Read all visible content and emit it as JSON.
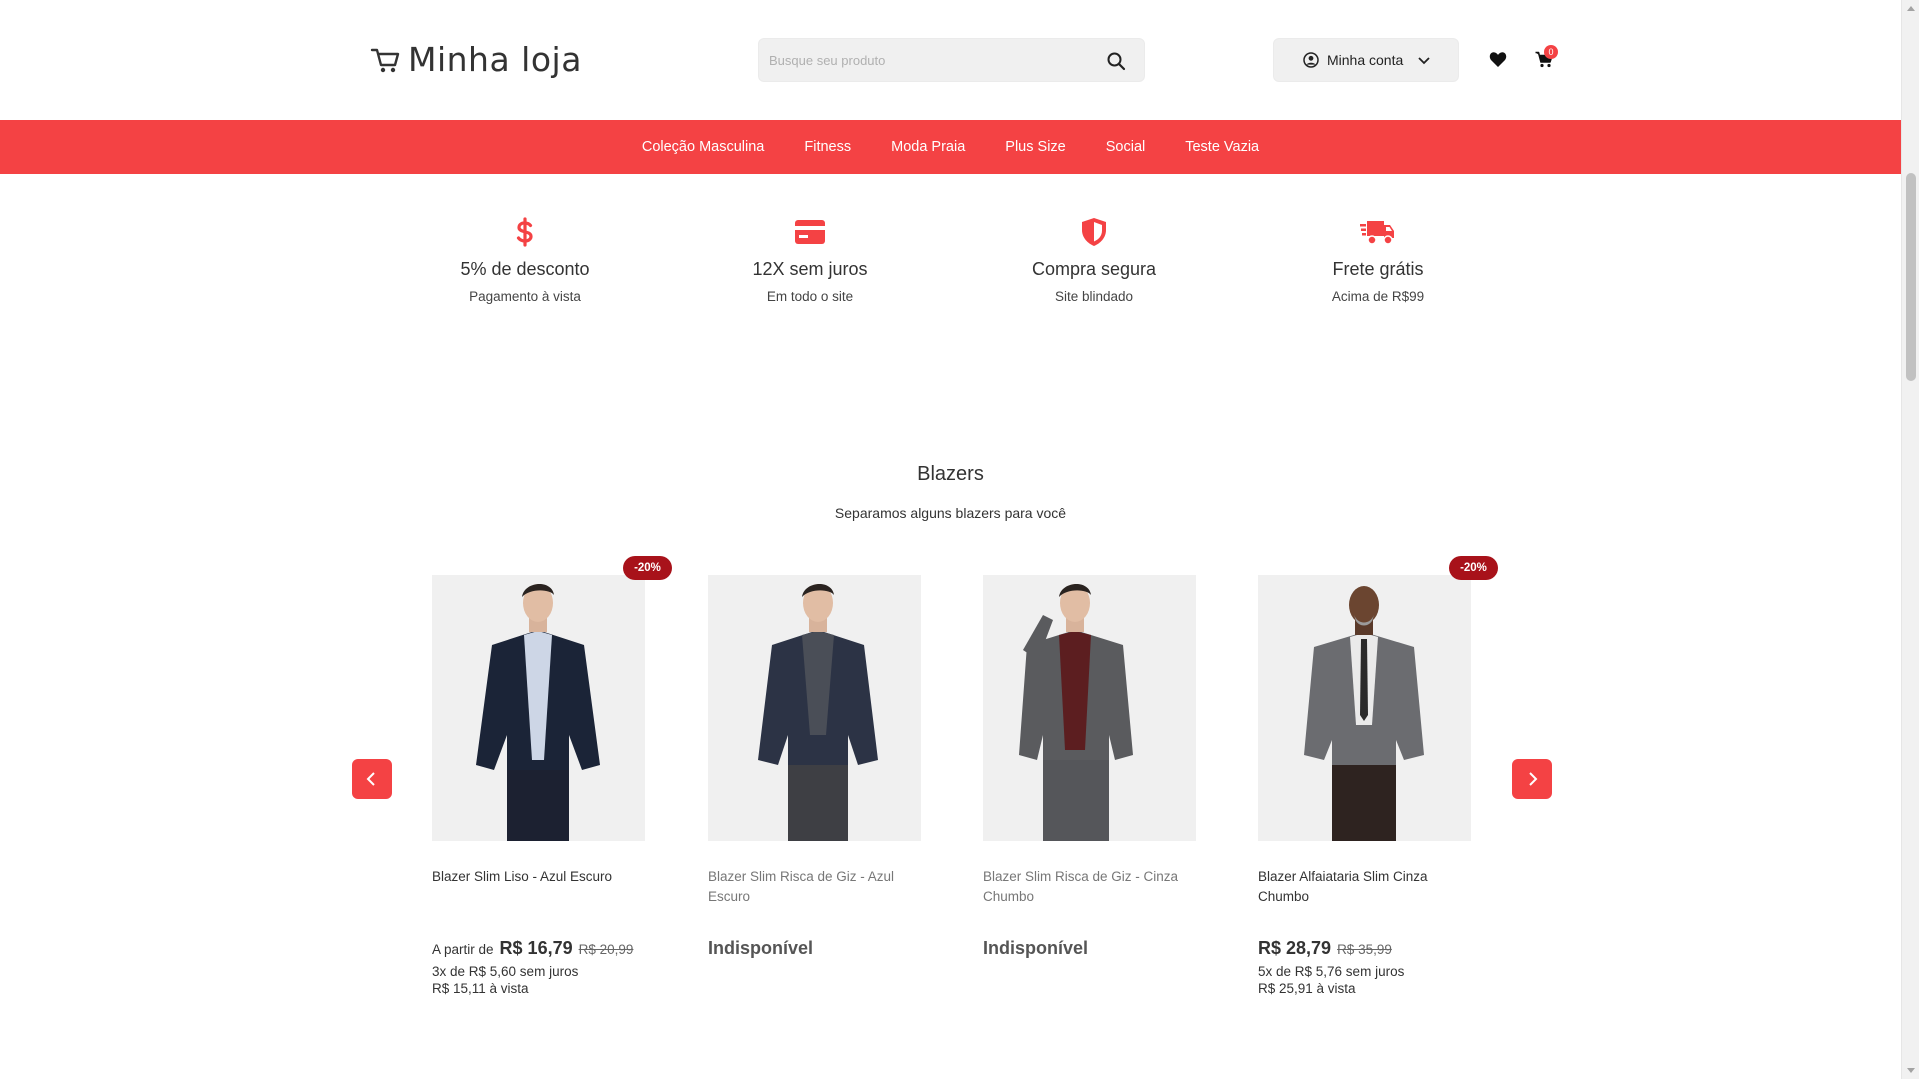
{
  "header": {
    "logo_text": "Minha loja",
    "search_placeholder": "Busque seu produto",
    "account_label": "Minha conta",
    "cart_count": "0"
  },
  "nav": {
    "items": [
      "Coleção Masculina",
      "Fitness",
      "Moda Praia",
      "Plus Size",
      "Social",
      "Teste Vazia"
    ]
  },
  "benefits": [
    {
      "icon": "dollar-icon",
      "title": "5% de desconto",
      "subtitle": "Pagamento à vista"
    },
    {
      "icon": "credit-card-icon",
      "title": "12X sem juros",
      "subtitle": "Em todo o site"
    },
    {
      "icon": "shield-icon",
      "title": "Compra segura",
      "subtitle": "Site blindado"
    },
    {
      "icon": "truck-icon",
      "title": "Frete grátis",
      "subtitle": "Acima de R$99"
    }
  ],
  "section": {
    "title": "Blazers",
    "subtitle": "Separamos alguns blazers para você"
  },
  "products": [
    {
      "name": "Blazer Slim Liso - Azul Escuro",
      "discount": "-20%",
      "prefix": "A partir de",
      "price": "R$ 16,79",
      "old_price": "R$ 20,99",
      "installments": "3x de R$ 5,60 sem juros",
      "cash": "R$ 15,11 à vista",
      "jacket_color": "#1b2437",
      "shirt_color": "#cdd6e6"
    },
    {
      "name": "Blazer Slim Risca de Giz - Azul Escuro",
      "unavailable": "Indisponível",
      "jacket_color": "#2c3345",
      "shirt_color": "#4a4e57"
    },
    {
      "name": "Blazer Slim Risca de Giz - Cinza Chumbo",
      "unavailable": "Indisponível",
      "jacket_color": "#5a5b5e",
      "shirt_color": "#5c1e20"
    },
    {
      "name": "Blazer Alfaiataria Slim Cinza Chumbo",
      "discount": "-20%",
      "price": "R$ 28,79",
      "old_price": "R$ 35,99",
      "installments": "5x de R$ 5,76 sem juros",
      "cash": "R$ 25,91 à vista",
      "jacket_color": "#6b6c70",
      "shirt_color": "#eaeaea"
    }
  ],
  "colors": {
    "accent": "#f44244",
    "discount_badge": "#a8121a"
  }
}
